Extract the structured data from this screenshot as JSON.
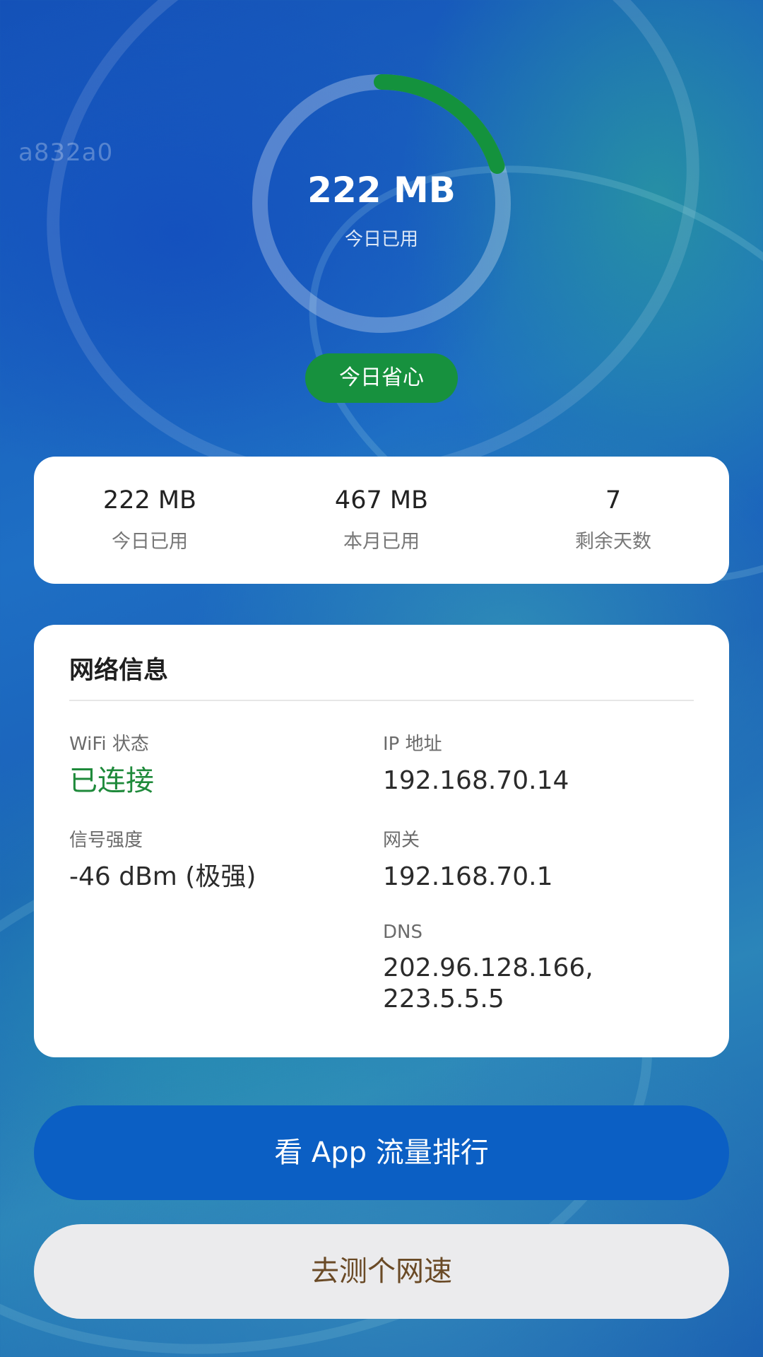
{
  "watermark": "a832a0",
  "usage_ring": {
    "value": "222 MB",
    "label": "今日已用",
    "progress": 0.2,
    "progress_color": "#14923d",
    "track_color": "rgba(255,255,255,0.28)"
  },
  "status_pill": "今日省心",
  "stats": [
    {
      "value": "222 MB",
      "label": "今日已用"
    },
    {
      "value": "467 MB",
      "label": "本月已用"
    },
    {
      "value": "7",
      "label": "剩余天数"
    }
  ],
  "network": {
    "title": "网络信息",
    "wifi_label": "WiFi 状态",
    "wifi_value": "已连接",
    "signal_label": "信号强度",
    "signal_value": "-46 dBm (极强)",
    "ip_label": "IP 地址",
    "ip_value": "192.168.70.14",
    "gateway_label": "网关",
    "gateway_value": "192.168.70.1",
    "dns_label": "DNS",
    "dns_line1": "202.96.128.166,",
    "dns_line2": "223.5.5.5"
  },
  "buttons": {
    "app_ranking": "看 App 流量排行",
    "speed_test": "去测个网速"
  },
  "colors": {
    "accent_green": "#17913e",
    "primary_blue": "#0b5fc4"
  }
}
